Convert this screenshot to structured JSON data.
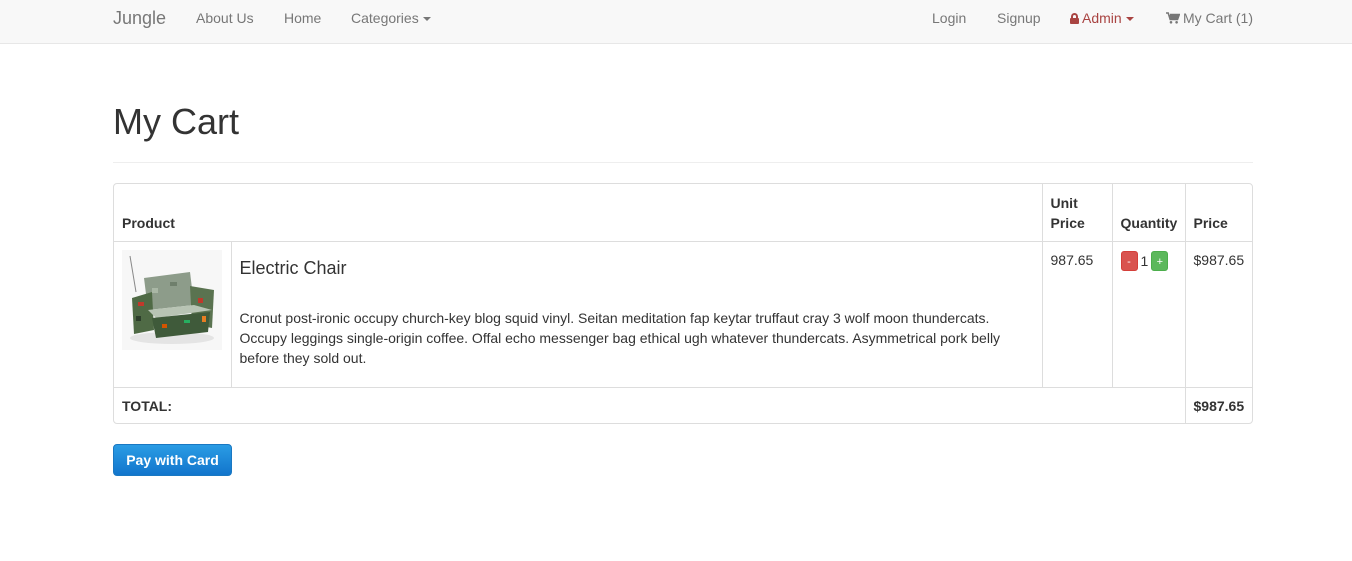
{
  "navbar": {
    "brand": "Jungle",
    "links": {
      "about": "About Us",
      "home": "Home",
      "categories": "Categories"
    },
    "right": {
      "login": "Login",
      "signup": "Signup",
      "admin": "Admin",
      "cart": "My Cart (1)"
    }
  },
  "page": {
    "title": "My Cart"
  },
  "cart": {
    "headers": {
      "product": "Product",
      "unit_price_line1": "Unit",
      "unit_price_line2": "Price",
      "quantity": "Quantity",
      "price": "Price"
    },
    "items": [
      {
        "name": "Electric Chair",
        "description": "Cronut post-ironic occupy church-key blog squid vinyl. Seitan meditation fap keytar truffaut cray 3 wolf moon thundercats. Occupy leggings single-origin coffee. Offal echo messenger bag ethical ugh whatever thundercats. Asymmetrical pork belly before they sold out.",
        "unit_price": "987.65",
        "quantity": "1",
        "minus_label": "-",
        "plus_label": "+",
        "price": "$987.65"
      }
    ],
    "total_label": "TOTAL:",
    "total_value": "$987.65"
  },
  "pay_button": "Pay with Card",
  "colors": {
    "danger": "#d9534f",
    "success": "#5cb85c",
    "admin": "#a94442",
    "pay_button": "#1a7fd1"
  }
}
